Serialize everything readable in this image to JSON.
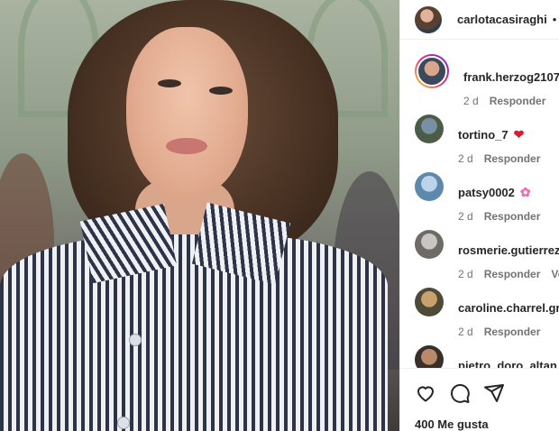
{
  "photo": {
    "alt": ""
  },
  "header": {
    "username": "carlotacasiraghi",
    "separator": "•"
  },
  "comments": [
    {
      "user": "frank.herzog2107",
      "time": "2 d",
      "reply": "Responder",
      "extra": "",
      "emoji": "",
      "avatar_colors": [
        "#d9a58b",
        "#3b4a5a"
      ],
      "story_ring": true
    },
    {
      "user": "tortino_7",
      "time": "2 d",
      "reply": "Responder",
      "extra": "",
      "emoji": "heart",
      "avatar_colors": [
        "#7a8fa4",
        "#4b5c48"
      ],
      "story_ring": false
    },
    {
      "user": "patsy0002",
      "time": "2 d",
      "reply": "Responder",
      "extra": "",
      "emoji": "flower",
      "avatar_colors": [
        "#bcd4ea",
        "#5f88ad"
      ],
      "story_ring": false
    },
    {
      "user": "rosmerie.gutierrez",
      "time": "2 d",
      "reply": "Responder",
      "extra": "Ver",
      "emoji": "",
      "avatar_colors": [
        "#c9c6c2",
        "#6e6a66"
      ],
      "story_ring": false
    },
    {
      "user": "caroline.charrel.gro",
      "time": "2 d",
      "reply": "Responder",
      "extra": "",
      "emoji": "",
      "avatar_colors": [
        "#c9a26b",
        "#4e4a3a"
      ],
      "story_ring": false
    },
    {
      "user": "pietro_doro_altan",
      "time": "",
      "reply": "",
      "extra": "",
      "emoji": "",
      "avatar_colors": [
        "#b88a6a",
        "#3a2e28"
      ],
      "story_ring": false
    }
  ],
  "actions": {
    "like_icon": "heart-outline-icon",
    "comment_icon": "comment-icon",
    "share_icon": "paper-plane-icon"
  },
  "likes": {
    "label": "400 Me gusta"
  }
}
